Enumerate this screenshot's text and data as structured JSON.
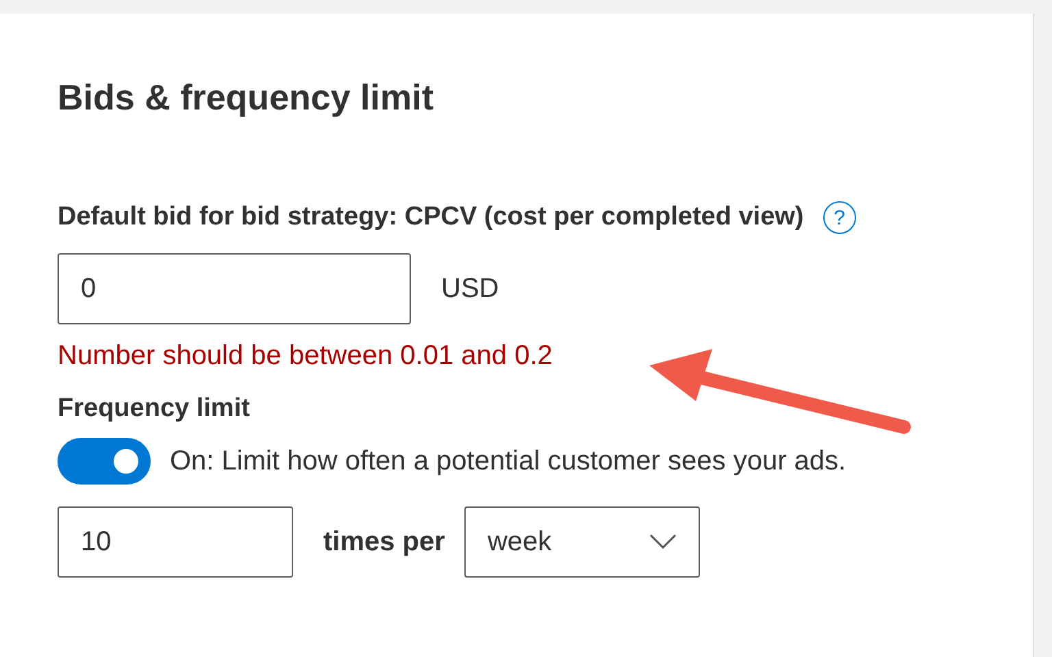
{
  "section": {
    "title": "Bids & frequency limit"
  },
  "default_bid": {
    "label": "Default bid for bid strategy: CPCV (cost per completed view)",
    "help_icon": "?",
    "value": "0",
    "currency": "USD",
    "error": "Number should be between 0.01 and 0.2"
  },
  "frequency_limit": {
    "label": "Frequency limit",
    "on": true,
    "toggle_label": "On: Limit how often a potential customer sees your ads.",
    "count": "10",
    "unit_label": "times per",
    "period": "week"
  },
  "annotation": {
    "kind": "arrow"
  }
}
